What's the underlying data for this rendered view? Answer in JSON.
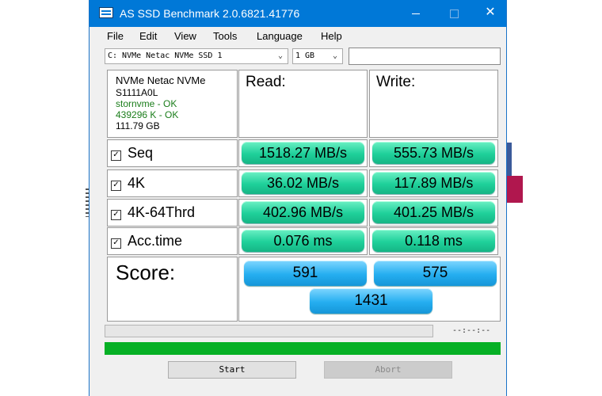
{
  "window": {
    "title": "AS SSD Benchmark 2.0.6821.41776",
    "controls": {
      "minimize": "",
      "maximize": "",
      "close": "✕"
    }
  },
  "menu": [
    "File",
    "Edit",
    "View",
    "Tools",
    "Language",
    "Help"
  ],
  "drive_select": {
    "value": "C: NVMe Netac NVMe SSD 1"
  },
  "size_select": {
    "value": "1 GB"
  },
  "extra_input": {
    "value": ""
  },
  "drive_info": {
    "model": "NVMe Netac NVMe",
    "firmware": "S1111A0L",
    "driver": "stornvme - OK",
    "alignment": "439296 K - OK",
    "capacity": "111.79 GB"
  },
  "columns": {
    "read": "Read:",
    "write": "Write:"
  },
  "rows": [
    {
      "label": "Seq",
      "checked": true,
      "read": "1518.27 MB/s",
      "write": "555.73 MB/s"
    },
    {
      "label": "4K",
      "checked": true,
      "read": "36.02 MB/s",
      "write": "117.89 MB/s"
    },
    {
      "label": "4K-64Thrd",
      "checked": true,
      "read": "402.96 MB/s",
      "write": "401.25 MB/s"
    },
    {
      "label": "Acc.time",
      "checked": true,
      "read": "0.076 ms",
      "write": "0.118 ms"
    }
  ],
  "score": {
    "label": "Score:",
    "read": "591",
    "write": "575",
    "total": "1431"
  },
  "elapsed": "--:--:--",
  "progress": {
    "benchmark_fraction": 0,
    "overall_fraction": 1.0
  },
  "buttons": {
    "start": "Start",
    "abort": "Abort"
  },
  "colors": {
    "titlebar": "#0078d7",
    "result": "#1fd09a",
    "score": "#25aef0",
    "progress": "#06b025"
  }
}
